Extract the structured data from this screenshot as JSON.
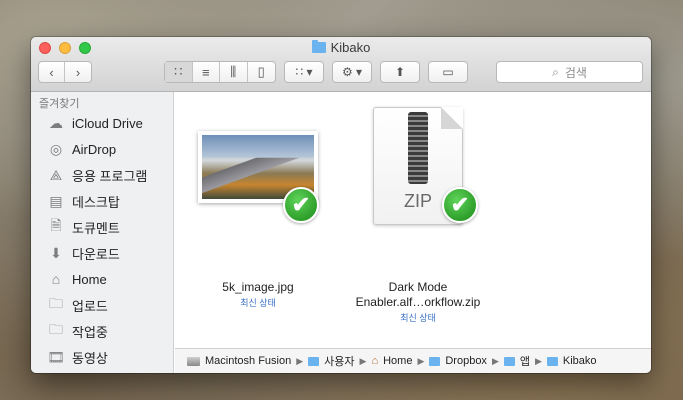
{
  "window": {
    "title": "Kibako"
  },
  "toolbar": {
    "view_icons": [
      "icon-view-icon",
      "list-view-icon",
      "column-view-icon",
      "coverflow-view-icon"
    ],
    "arrange_icon": "arrange-icon",
    "action_icon": "gear-icon",
    "share_icon": "share-icon",
    "tag_icon": "tag-icon",
    "search_placeholder": "검색"
  },
  "sidebar": {
    "heading": "즐겨찾기",
    "items": [
      {
        "label": "iCloud Drive",
        "icon": "cloud-icon"
      },
      {
        "label": "AirDrop",
        "icon": "airdrop-icon"
      },
      {
        "label": "응용 프로그램",
        "icon": "applications-icon"
      },
      {
        "label": "데스크탑",
        "icon": "desktop-icon"
      },
      {
        "label": "도큐멘트",
        "icon": "document-icon"
      },
      {
        "label": "다운로드",
        "icon": "download-icon"
      },
      {
        "label": "Home",
        "icon": "home-icon"
      },
      {
        "label": "업로드",
        "icon": "folder-icon"
      },
      {
        "label": "작업중",
        "icon": "folder-icon"
      },
      {
        "label": "동영상",
        "icon": "movies-icon"
      }
    ]
  },
  "files": [
    {
      "name": "5k_image.jpg",
      "status": "최신 상태",
      "type": "image"
    },
    {
      "name_line1": "Dark Mode",
      "name_line2": "Enabler.alf…orkflow.zip",
      "status": "최신 상태",
      "type": "zip",
      "badge": "ZIP"
    }
  ],
  "pathbar": [
    "Macintosh Fusion",
    "사용자",
    "Home",
    "Dropbox",
    "앱",
    "Kibako"
  ],
  "colors": {
    "status_blue": "#3a70c6",
    "check_green": "#2e9f2a",
    "folder_blue": "#6ab3ee"
  }
}
